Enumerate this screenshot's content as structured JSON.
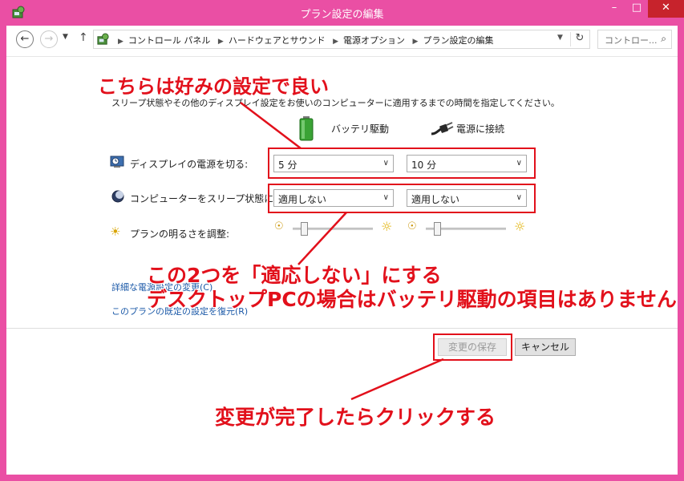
{
  "window": {
    "title": "プラン設定の編集"
  },
  "address": {
    "breadcrumbs": [
      "コントロール パネル",
      "ハードウェアとサウンド",
      "電源オプション",
      "プラン設定の編集"
    ],
    "search_placeholder": "コントロー..."
  },
  "main": {
    "description": "スリープ状態やその他のディスプレイ設定をお使いのコンピューターに適用するまでの時間を指定してください。",
    "columns": {
      "battery": "バッテリ駆動",
      "plugged": "電源に接続"
    },
    "display_off": {
      "label": "ディスプレイの電源を切る:",
      "battery": "5 分",
      "plugged": "10 分"
    },
    "sleep": {
      "label": "コンピューターをスリープ状態にする:",
      "battery": "適用しない",
      "plugged": "適用しない"
    },
    "brightness": {
      "label": "プランの明るさを調整:",
      "battery_level": 0.0,
      "plugged_level": 0.0
    },
    "links": {
      "advanced": "詳細な電源設定の変更(C)",
      "restore": "このプランの既定の設定を復元(R)"
    }
  },
  "buttons": {
    "save": "変更の保存",
    "cancel": "キャンセル"
  },
  "annotations": {
    "top": "こちらは好みの設定で良い",
    "middle_line1": "この2つを「適応しない」にする",
    "middle_line2": "デスクトップPCの場合はバッテリ駆動の項目はありません",
    "bottom": "変更が完了したらクリックする"
  },
  "colors": {
    "frame": "#ea4fa4",
    "annotation": "#e2101b",
    "link": "#1c5aa8"
  }
}
